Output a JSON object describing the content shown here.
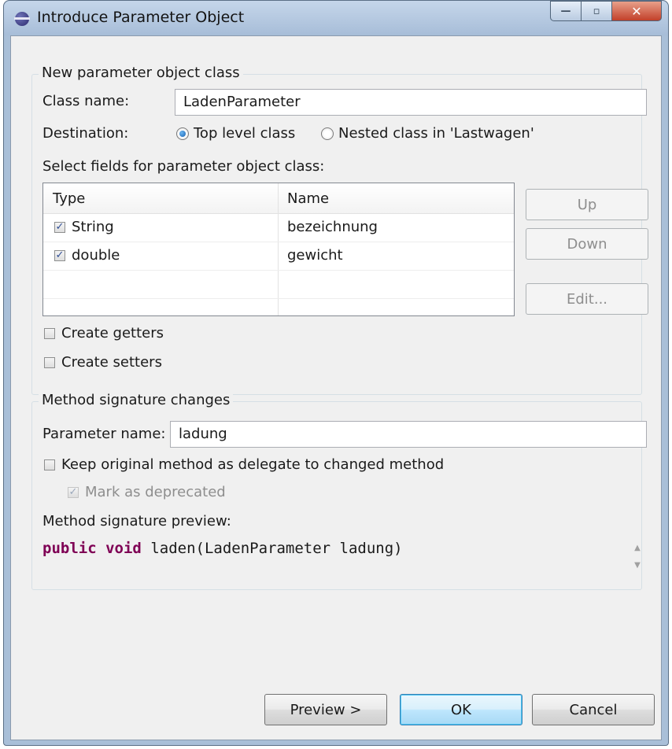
{
  "window": {
    "title": "Introduce Parameter Object",
    "minimize_glyph": "—",
    "maximize_glyph": "▫",
    "close_glyph": "✕"
  },
  "new_class": {
    "group_title": "New parameter object class",
    "class_name_label": "Class name:",
    "class_name_value": "LadenParameter",
    "destination_label": "Destination:",
    "radio_top_level": "Top level class",
    "radio_nested": "Nested class in 'Lastwagen'",
    "fields_label": "Select fields for parameter object class:",
    "columns": [
      "Type",
      "Name"
    ],
    "rows": [
      {
        "type": "String",
        "name": "bezeichnung",
        "checked": true
      },
      {
        "type": "double",
        "name": "gewicht",
        "checked": true
      }
    ],
    "btn_up": "Up",
    "btn_down": "Down",
    "btn_edit": "Edit...",
    "create_getters": "Create getters",
    "create_setters": "Create setters"
  },
  "method_changes": {
    "group_title": "Method signature changes",
    "param_name_label": "Parameter name:",
    "param_name_value": "ladung",
    "keep_original": "Keep original method as delegate to changed method",
    "mark_deprecated": "Mark as deprecated",
    "preview_label": "Method signature preview:",
    "preview_kw1": "public",
    "preview_kw2": "void",
    "preview_rest": "laden(LadenParameter ladung)"
  },
  "footer": {
    "preview_button": "Preview >",
    "ok_button": "OK",
    "cancel_button": "Cancel"
  },
  "colors": {
    "keyword": "#7f0055",
    "title_bar": "#a9bfd8",
    "dialog_bg": "#f0f0f0"
  },
  "icons": {
    "check": "✓",
    "scroll_up": "▲",
    "scroll_down": "▼"
  }
}
